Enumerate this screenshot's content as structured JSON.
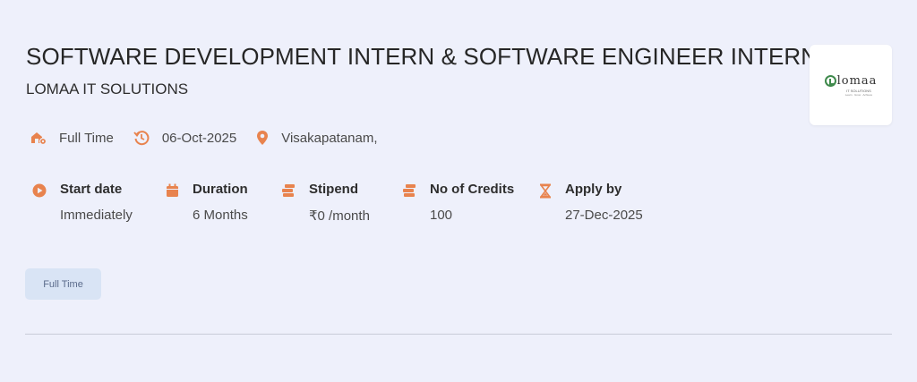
{
  "job": {
    "title": "SOFTWARE DEVELOPMENT INTERN & SOFTWARE ENGINEER INTERN",
    "company": "LOMAA IT SOLUTIONS"
  },
  "logo": {
    "text": "lomaa",
    "subtitle": "IT SOLUTIONS",
    "tagline": "Learn . Grow . Achieve"
  },
  "meta": {
    "job_type": "Full Time",
    "posted_date": "06-Oct-2025",
    "location": "Visakapatanam,"
  },
  "details": {
    "start_date": {
      "label": "Start date",
      "value": "Immediately"
    },
    "duration": {
      "label": "Duration",
      "value": "6 Months"
    },
    "stipend": {
      "label": "Stipend",
      "value": "₹0 /month"
    },
    "credits": {
      "label": "No of Credits",
      "value": "100"
    },
    "apply_by": {
      "label": "Apply by",
      "value": "27-Dec-2025"
    }
  },
  "tags": [
    "Full Time"
  ],
  "colors": {
    "accent": "#e8834e",
    "background": "#eef0fb",
    "tag_bg": "#d9e4f5"
  }
}
